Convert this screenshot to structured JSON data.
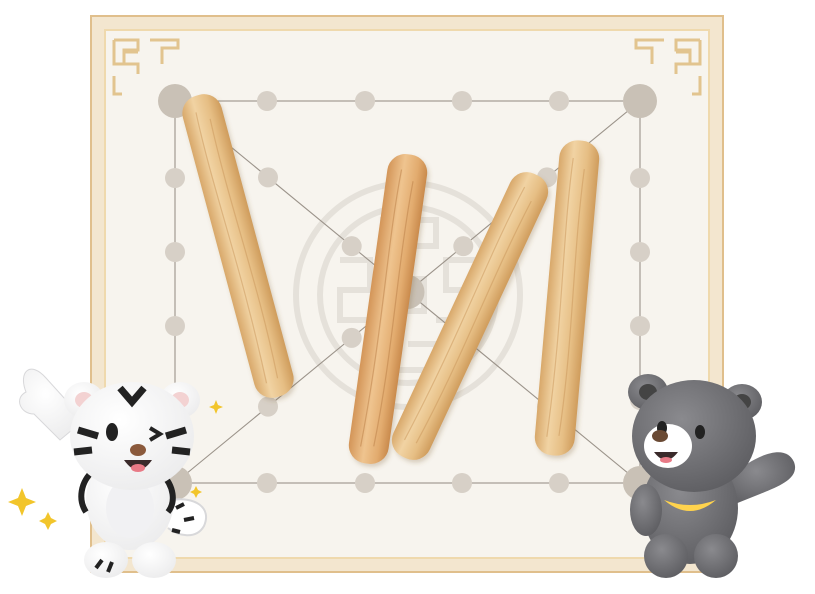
{
  "game": "Yut Nori",
  "board": {
    "frame_color": "#e6c995",
    "paper_color": "#f6f2ea",
    "node_color": "#d7d0c7",
    "line_color": "#9b938a"
  },
  "yut_sticks": [
    {
      "name": "yut-stick-1",
      "color": "#e9c88f"
    },
    {
      "name": "yut-stick-2",
      "color": "#e4b57c"
    },
    {
      "name": "yut-stick-3",
      "color": "#eacb92"
    },
    {
      "name": "yut-stick-4",
      "color": "#e9c88f"
    }
  ],
  "characters": [
    {
      "name": "white-tiger-mascot",
      "color": "#ffffff",
      "stripe_color": "#222222"
    },
    {
      "name": "black-bear-mascot",
      "color": "#6f6f72",
      "crescent_color": "#ffd34d"
    }
  ],
  "icons": [
    "sparkle-icon",
    "corner-ornament-icon",
    "center-emblem-icon"
  ]
}
